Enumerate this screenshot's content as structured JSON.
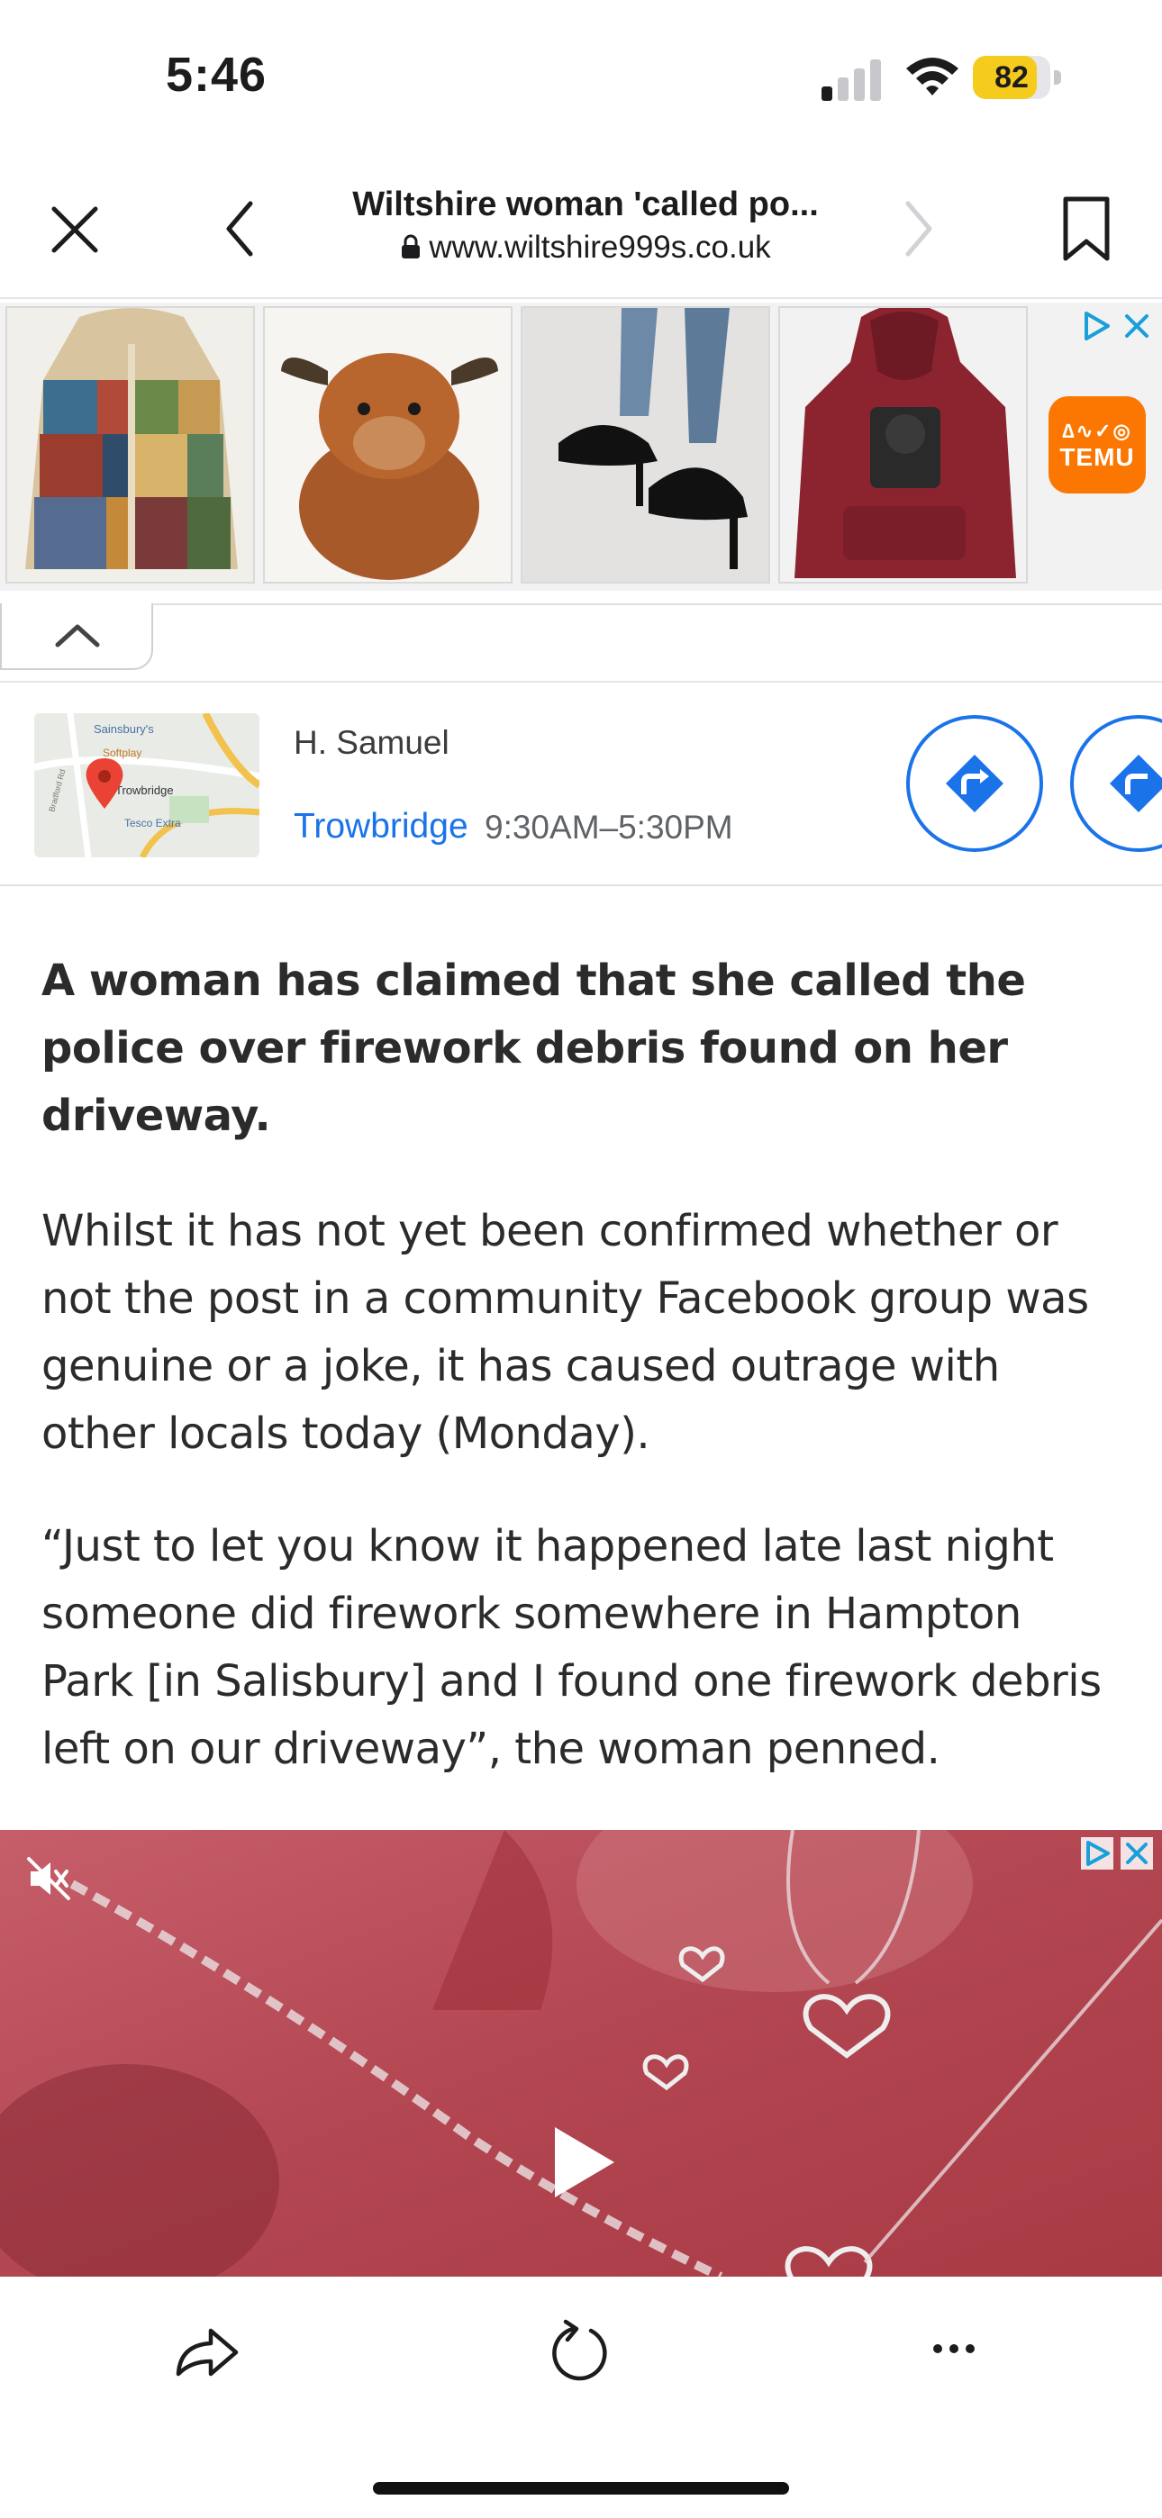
{
  "status_bar": {
    "time": "5:46",
    "battery_percent": "82",
    "battery_level": 0.82,
    "signal_bars_active": 1,
    "signal_bars_total": 4
  },
  "header": {
    "title": "Wiltshire woman 'called po...",
    "url": "www.wiltshire999s.co.uk"
  },
  "ad_strip": {
    "products": [
      {
        "name": "patchwork-hooded-coat"
      },
      {
        "name": "highland-cow-plush"
      },
      {
        "name": "black-peep-toe-heels"
      },
      {
        "name": "burgundy-cat-hoodie"
      }
    ],
    "advertiser": "TEMU",
    "advertiser_symbol": "∆∿✓◎"
  },
  "map_card": {
    "map_labels": {
      "poi1": "Sainsbury's",
      "poi2": "Softplay",
      "town": "Trowbridge",
      "poi3": "Tesco Extra",
      "road": "Bradford Rd"
    },
    "store_name": "H. Samuel",
    "city": "Trowbridge",
    "hours": "9:30AM–5:30PM"
  },
  "article": {
    "lead": "A woman has claimed that she called the police over firework debris found on her driveway.",
    "para1": "Whilst it has not yet been confirmed whether or not the post in a community Facebook group was genuine or a joke, it has caused outrage with other locals today (Monday).",
    "para2": "“Just to let you know it happened late last night someone did firework somewhere in Hampton Park [in Salisbury] and I found one firework debris left on our driveway”, the woman penned."
  },
  "colors": {
    "link_blue": "#1a73e8",
    "temu_orange": "#fb7701",
    "battery_yellow": "#f5cc1d",
    "ad_choices": "#1a9fd9"
  }
}
